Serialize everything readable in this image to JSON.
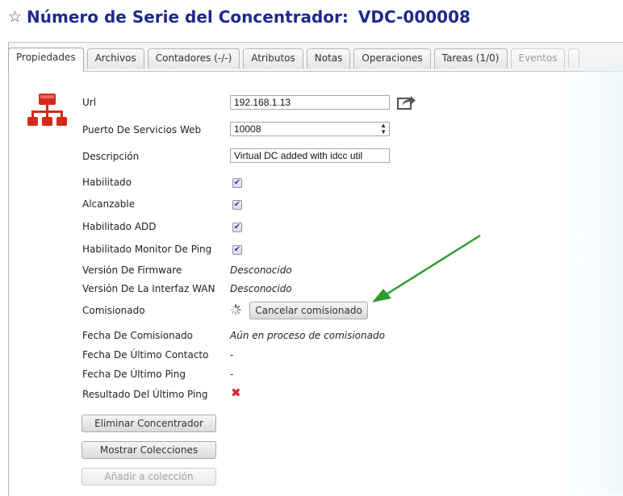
{
  "header": {
    "title_prefix": "Número de Serie del Concentrador:",
    "serial": "VDC-000008"
  },
  "tabs": [
    {
      "label": "Propiedades",
      "active": true
    },
    {
      "label": "Archivos"
    },
    {
      "label": "Contadores (-/-)"
    },
    {
      "label": "Atributos"
    },
    {
      "label": "Notas"
    },
    {
      "label": "Operaciones"
    },
    {
      "label": "Tareas (1/0)"
    },
    {
      "label": "Eventos"
    },
    {
      "label": ""
    }
  ],
  "properties": {
    "url": {
      "label": "Url",
      "value": "192.168.1.13"
    },
    "web_port": {
      "label": "Puerto De Servicios Web",
      "value": "10008"
    },
    "description": {
      "label": "Descripción",
      "value": "Virtual DC added with idcc util"
    },
    "enabled": {
      "label": "Habilitado",
      "checked": true
    },
    "reachable": {
      "label": "Alcanzable",
      "checked": true
    },
    "add_enabled": {
      "label": "Habilitado ADD",
      "checked": true
    },
    "ping_monitor": {
      "label": "Habilitado Monitor De Ping",
      "checked": true
    },
    "firmware": {
      "label": "Versión De Firmware",
      "value": "Desconocido"
    },
    "wan_version": {
      "label": "Versión De La Interfaz WAN",
      "value": "Desconocido"
    },
    "commissioned": {
      "label": "Comisionado",
      "button": "Cancelar comisionado"
    },
    "commission_date": {
      "label": "Fecha De Comisionado",
      "value": "Aún en proceso de comisionado"
    },
    "last_contact": {
      "label": "Fecha De Último Contacto",
      "value": "-"
    },
    "last_ping_date": {
      "label": "Fecha De Último Ping",
      "value": "-"
    },
    "last_ping_result": {
      "label": "Resultado Del Último Ping",
      "icon": "x-mark-icon"
    }
  },
  "actions": {
    "delete": "Eliminar Concentrador",
    "show_collections": "Mostrar Colecciones",
    "add_to_collection": "Añadir a colección"
  },
  "colors": {
    "title": "#1f2a8a",
    "hub_icon": "#d42a1a",
    "arrow": "#2f9b2b",
    "error": "#dd2222"
  }
}
